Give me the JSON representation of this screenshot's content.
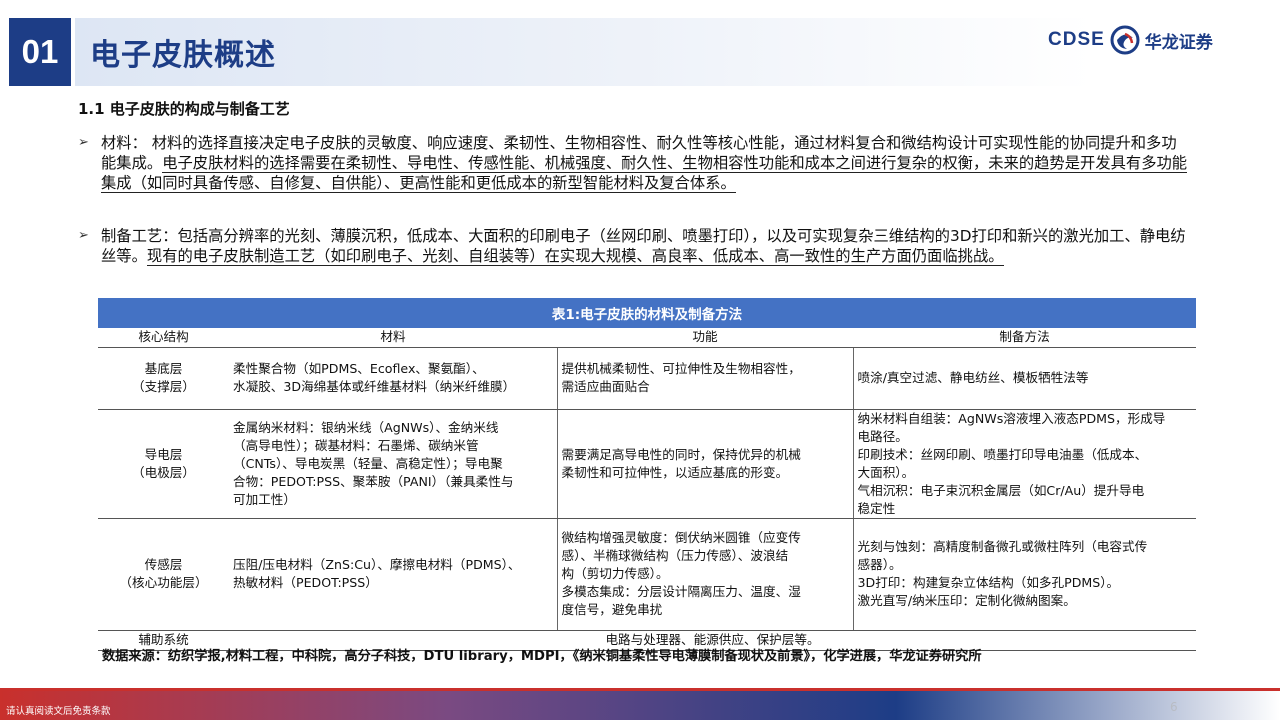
{
  "section": {
    "number": "01",
    "title": "电子皮肤概述"
  },
  "logo": {
    "brand": "CDSE",
    "name": "华龙证券"
  },
  "subheading": "1.1 电子皮肤的构成与制备工艺",
  "bullets": [
    {
      "plain": "材料： 材料的选择直接决定电子皮肤的灵敏度、响应速度、柔韧性、生物相容性、耐久性等核心性能，通过材料复合和微结构设计可实现性能的协同提升和多功能集成。",
      "underlined": "电子皮肤材料的选择需要在柔韧性、导电性、传感性能、机械强度、耐久性、生物相容性功能和成本之间进行复杂的权衡，未来的趋势是开发具有多功能集成（如同时具备传感、自修复、自供能）、更高性能和更低成本的新型智能材料及复合体系。"
    },
    {
      "plain": "制备工艺：包括高分辨率的光刻、薄膜沉积，低成本、大面积的印刷电子（丝网印刷、喷墨打印），以及可实现复杂三维结构的3D打印和新兴的激光加工、静电纺丝等。",
      "underlined": "现有的电子皮肤制造工艺（如印刷电子、光刻、自组装等）在实现大规模、高良率、低成本、高一致性的生产方面仍面临挑战。"
    }
  ],
  "table": {
    "caption": "表1:电子皮肤的材料及制备方法",
    "headers": [
      "核心结构",
      "材料",
      "功能",
      "制备方法"
    ],
    "rows": [
      {
        "key": [
          "基底层",
          "（支撑层）"
        ],
        "material": [
          "柔性聚合物（如PDMS、Ecoflex、聚氨酯）、",
          "水凝胶、3D海绵基体或纤维基材料（纳米纤维膜）"
        ],
        "function": [
          "提供机械柔韧性、可拉伸性及生物相容性，",
          "需适应曲面贴合"
        ],
        "method": [
          "喷涂/真空过滤、静电纺丝、模板牺牲法等"
        ]
      },
      {
        "key": [
          "导电层",
          "（电极层）"
        ],
        "material": [
          "金属纳米材料：银纳米线（AgNWs）、金纳米线",
          "（高导电性）；碳基材料：石墨烯、碳纳米管",
          "（CNTs）、导电炭黑（轻量、高稳定性）；导电聚",
          "合物：PEDOT:PSS、聚苯胺（PANI）（兼具柔性与",
          "可加工性）"
        ],
        "function": [
          "需要满足高导电性的同时，保持优异的机械",
          "柔韧性和可拉伸性，以适应基底的形变。"
        ],
        "method": [
          "纳米材料自组装：AgNWs溶液埋入液态PDMS，形成导",
          "电路径。",
          "印刷技术：丝网印刷、喷墨打印导电油墨（低成本、",
          "大面积）。",
          "气相沉积：电子束沉积金属层（如Cr/Au）提升导电",
          "稳定性"
        ]
      },
      {
        "key": [
          "传感层",
          "（核心功能层）"
        ],
        "material": [
          "压阻/压电材料（ZnS:Cu）、摩擦电材料（PDMS）、",
          "热敏材料（PEDOT:PSS）"
        ],
        "function": [
          "微结构增强灵敏度：倒伏纳米圆锥（应变传",
          "感）、半椭球微结构（压力传感）、波浪结",
          "构（剪切力传感）。",
          "多模态集成：分层设计隔离压力、温度、湿",
          "度信号，避免串扰"
        ],
        "method": [
          "光刻与蚀刻：高精度制备微孔或微柱阵列（电容式传",
          "感器）。",
          "3D打印：构建复杂立体结构（如多孔PDMS）。",
          "激光直写/纳米压印：定制化微納图案。"
        ]
      }
    ],
    "aux": {
      "key": "辅助系统",
      "text": "电路与处理器、能源供应、保护层等。"
    }
  },
  "source": "数据来源：纺织学报,材料工程，中科院，高分子科技，DTU library，MDPI，《纳米铜基柔性导电薄膜制备现状及前景》，化学进展，华龙证券研究所",
  "footer": {
    "disclaimer": "请认真阅读文后免责条款",
    "page": "6"
  },
  "colors": {
    "primary": "#1d3d86",
    "table_header": "#4472c4",
    "footer_red": "#c9302c"
  }
}
